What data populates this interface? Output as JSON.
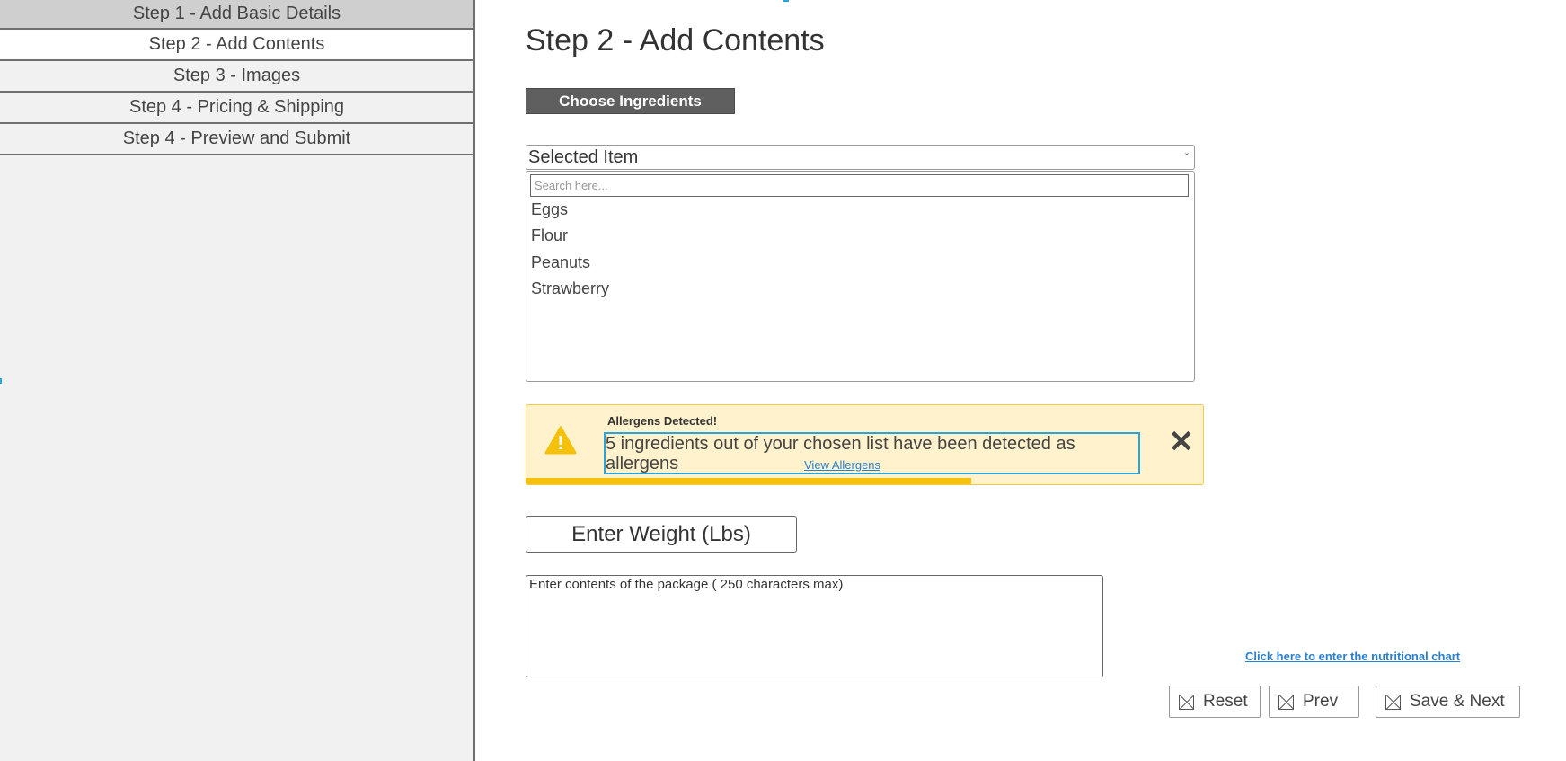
{
  "sidebar": {
    "steps": [
      {
        "label": "Step 1 - Add Basic Details"
      },
      {
        "label": "Step 2 - Add Contents"
      },
      {
        "label": "Step 3 - Images"
      },
      {
        "label": "Step 4 - Pricing & Shipping"
      },
      {
        "label": "Step 4 - Preview and Submit"
      }
    ],
    "active_index": 1
  },
  "main": {
    "title": "Step 2 - Add Contents",
    "choose_button": "Choose Ingredients",
    "select": {
      "value": "Selected Item",
      "chevron": "ˇ",
      "search_placeholder": "Search here...",
      "options": [
        "Eggs",
        "Flour",
        "Peanuts",
        "Strawberry"
      ]
    },
    "alert": {
      "icon": "warning-icon",
      "heading": "Allergens Detected!",
      "message": "5 ingredients out of your chosen list have been detected as allergens",
      "link": "View Allergens",
      "close": "✕",
      "colors": {
        "background": "#fff2cc",
        "bar": "#f6c10a",
        "focus": "#2aa4dc"
      }
    },
    "weight_placeholder": "Enter Weight (Lbs)",
    "contents_placeholder": "Enter contents of the package ( 250 characters max)",
    "nutrition_link": "Click here to enter the nutritional chart",
    "buttons": {
      "reset": "Reset",
      "prev": "Prev",
      "save_next": "Save & Next"
    }
  }
}
